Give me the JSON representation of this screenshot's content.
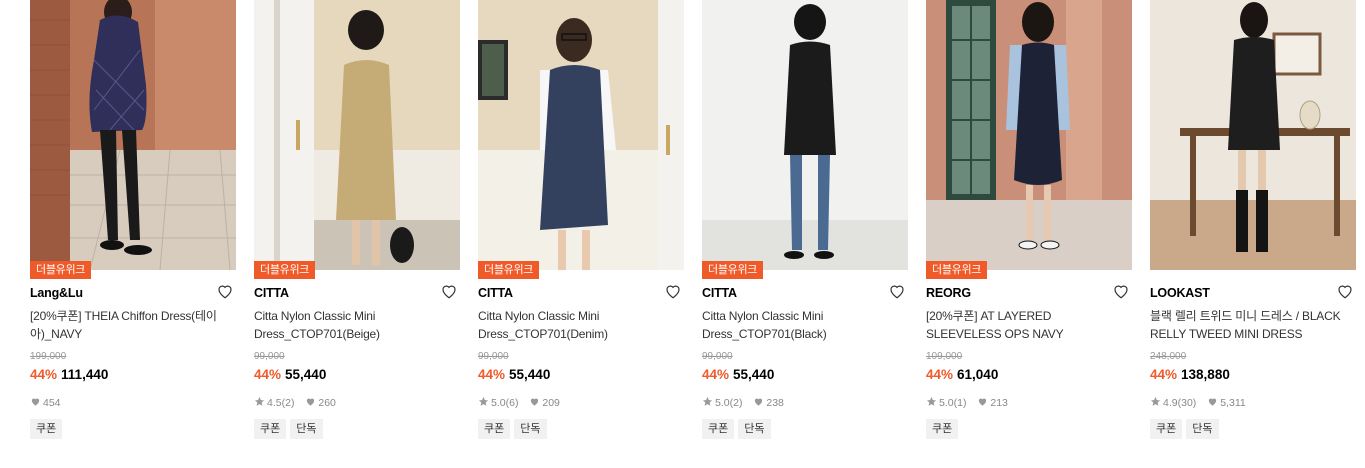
{
  "products": [
    {
      "badge": "더블유위크",
      "brand": "Lang&Lu",
      "title": "[20%쿠폰] THEIA Chiffon Dress(테이아)_NAVY",
      "original_price": "199,000",
      "discount": "44%",
      "price": "111,440",
      "rating": "",
      "reviews": "",
      "likes": "454",
      "tags": [
        "쿠폰"
      ],
      "image_desc": "brick-wall-navy-plaid-dress"
    },
    {
      "badge": "더블유위크",
      "brand": "CITTA",
      "title": "Citta Nylon Classic Mini Dress_CTOP701(Beige)",
      "original_price": "99,000",
      "discount": "44%",
      "price": "55,440",
      "rating": "4.5",
      "reviews": "(2)",
      "likes": "260",
      "tags": [
        "쿠폰",
        "단독"
      ],
      "image_desc": "beige-mini-dress"
    },
    {
      "badge": "더블유위크",
      "brand": "CITTA",
      "title": "Citta Nylon Classic Mini Dress_CTOP701(Denim)",
      "original_price": "99,000",
      "discount": "44%",
      "price": "55,440",
      "rating": "5.0",
      "reviews": "(6)",
      "likes": "209",
      "tags": [
        "쿠폰",
        "단독"
      ],
      "image_desc": "denim-mini-dress"
    },
    {
      "badge": "더블유위크",
      "brand": "CITTA",
      "title": "Citta Nylon Classic Mini Dress_CTOP701(Black)",
      "original_price": "99,000",
      "discount": "44%",
      "price": "55,440",
      "rating": "5.0",
      "reviews": "(2)",
      "likes": "238",
      "tags": [
        "쿠폰",
        "단독"
      ],
      "image_desc": "black-mini-dress"
    },
    {
      "badge": "더블유위크",
      "brand": "REORG",
      "title": "[20%쿠폰] AT LAYERED SLEEVELESS OPS NAVY",
      "original_price": "109,000",
      "discount": "44%",
      "price": "61,040",
      "rating": "5.0",
      "reviews": "(1)",
      "likes": "213",
      "tags": [
        "쿠폰"
      ],
      "image_desc": "navy-layered-dress"
    },
    {
      "badge": "",
      "brand": "LOOKAST",
      "title": "블랙 렐리 트위드 미니 드레스 / BLACK RELLY TWEED MINI DRESS",
      "original_price": "248,000",
      "discount": "44%",
      "price": "138,880",
      "rating": "4.9",
      "reviews": "(30)",
      "likes": "5,311",
      "tags": [
        "쿠폰",
        "단독"
      ],
      "image_desc": "black-tweed-mini-dress"
    }
  ],
  "colors": {
    "accent": "#f05a28",
    "muted": "#888888"
  }
}
